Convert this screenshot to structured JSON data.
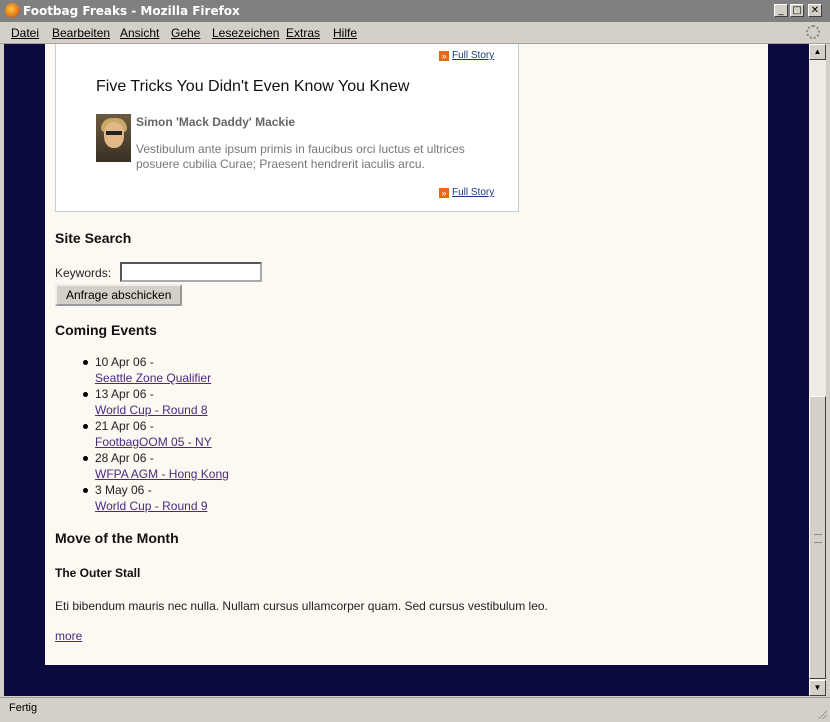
{
  "window": {
    "title": "Footbag Freaks - Mozilla Firefox",
    "minimize_glyph": "_",
    "maximize_glyph": "□",
    "close_glyph": "✕"
  },
  "menu": [
    "Datei",
    "Bearbeiten",
    "Ansicht",
    "Gehe",
    "Lesezeichen",
    "Extras",
    "Hilfe"
  ],
  "featured": {
    "full_story_label": "Full Story",
    "article_title": "Five Tricks You Didn't Even Know You Knew",
    "author": "Simon 'Mack Daddy' Mackie",
    "excerpt": "Vestibulum ante ipsum primis in faucibus orci luctus et ultrices posuere cubilia Curae; Praesent hendrerit iaculis arcu."
  },
  "search": {
    "heading": "Site Search",
    "keywords_label": "Keywords:",
    "keywords_value": "",
    "submit_label": "Anfrage abschicken"
  },
  "events": {
    "heading": "Coming Events",
    "items": [
      {
        "date": "10 Apr 06 -",
        "title": "Seattle Zone Qualifier"
      },
      {
        "date": "13 Apr 06 -",
        "title": "World Cup - Round 8"
      },
      {
        "date": "21 Apr 06 -",
        "title": "FootbagOOM 05 - NY"
      },
      {
        "date": "28 Apr 06 -",
        "title": "WFPA AGM - Hong Kong"
      },
      {
        "date": "3 May 06 -",
        "title": "World Cup - Round 9"
      }
    ]
  },
  "move": {
    "heading": "Move of the Month",
    "title": "The Outer Stall",
    "text": "Eti bibendum mauris nec nulla. Nullam cursus ullamcorper quam. Sed cursus vestibulum leo.",
    "more_label": "more"
  },
  "status": {
    "text": "Fertig"
  },
  "icons": {
    "app": "firefox-icon",
    "full_story": "arrow-right-icon",
    "throbber": "throbber-icon"
  },
  "colors": {
    "page_bg": "#0b0b3d",
    "content_bg": "#fcf8f2",
    "link": "#4b2a80",
    "full_story_arrow": "#e86a10"
  }
}
